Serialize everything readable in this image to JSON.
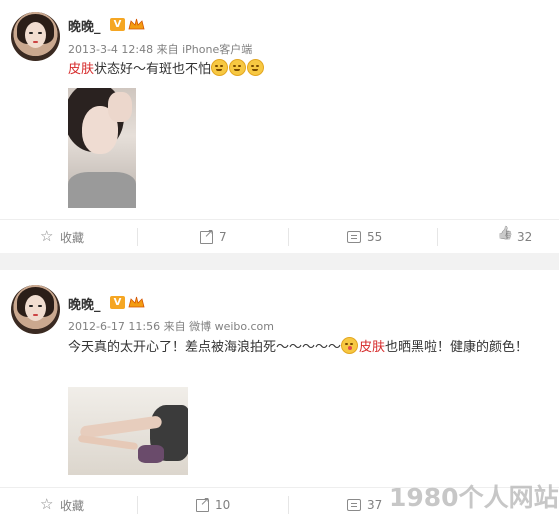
{
  "posts": [
    {
      "username": "晚晚_",
      "vbadge": "V",
      "meta": "2013-3-4 12:48 来自 iPhone客户端",
      "text_highlight": "皮肤",
      "text_rest": "状态好～有斑也不怕",
      "actions": {
        "favorite": "收藏",
        "repost": "7",
        "comment": "55",
        "like": "32"
      }
    },
    {
      "username": "晚晚_",
      "vbadge": "V",
      "meta": "2012-6-17 11:56 来自 微博 weibo.com",
      "text_before": "今天真的太开心了！差点被海浪拍死～～～～～",
      "text_highlight": "皮肤",
      "text_after": "也晒黑啦！健康的颜色！",
      "actions": {
        "favorite": "收藏",
        "repost": "10",
        "comment": "37",
        "like": ""
      }
    }
  ],
  "watermark": "1980个人网站",
  "colors": {
    "highlight": "#d62b2b",
    "meta": "#808080",
    "badge": "#f5a623"
  }
}
